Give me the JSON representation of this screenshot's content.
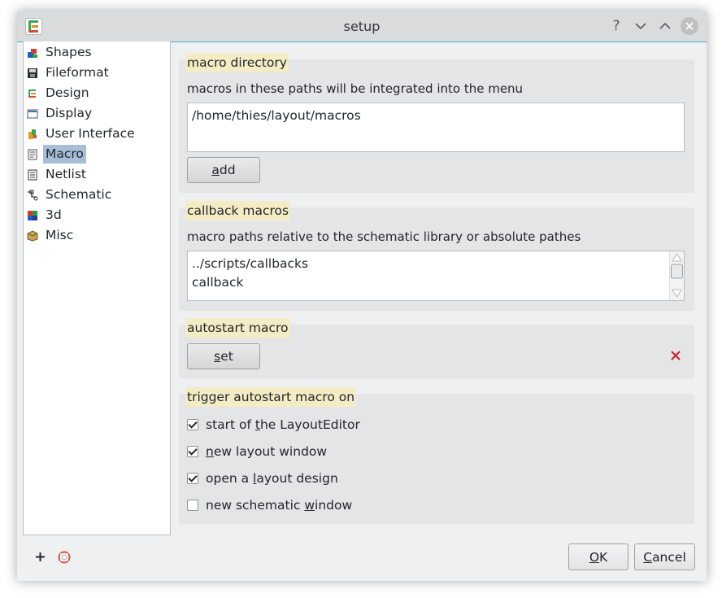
{
  "window": {
    "title": "setup"
  },
  "titlebar": {
    "help": "?",
    "minimize": "⌄",
    "maximize": "⌃",
    "close": "✕"
  },
  "sidebar": {
    "items": [
      {
        "label": "Shapes",
        "icon": "shapes-icon"
      },
      {
        "label": "Fileformat",
        "icon": "floppy-disk-icon"
      },
      {
        "label": "Design",
        "icon": "design-icon"
      },
      {
        "label": "Display",
        "icon": "display-icon"
      },
      {
        "label": "User Interface",
        "icon": "user-interface-icon"
      },
      {
        "label": "Macro",
        "icon": "macro-icon",
        "selected": true
      },
      {
        "label": "Netlist",
        "icon": "netlist-icon"
      },
      {
        "label": "Schematic",
        "icon": "schematic-icon"
      },
      {
        "label": "3d",
        "icon": "3d-icon"
      },
      {
        "label": "Misc",
        "icon": "misc-icon"
      }
    ]
  },
  "macro_directory": {
    "title": "macro directory",
    "description": "macros in these paths will be integrated into the menu",
    "paths": [
      "/home/thies/layout/macros"
    ],
    "add_button": {
      "pre": "",
      "key": "a",
      "post": "dd"
    }
  },
  "callback_macros": {
    "title": "callback macros",
    "description": "macro paths relative to the schematic library or absolute pathes",
    "paths": [
      "../scripts/callbacks",
      "callback"
    ]
  },
  "autostart_macro": {
    "title": "autostart macro",
    "set_button": {
      "pre": "",
      "key": "s",
      "post": "et"
    }
  },
  "trigger": {
    "title": "trigger autostart macro on",
    "options": [
      {
        "pre": "start of ",
        "key": "t",
        "post": "he LayoutEditor",
        "checked": true
      },
      {
        "pre": "",
        "key": "n",
        "post": "ew layout window",
        "checked": true
      },
      {
        "pre": "open a ",
        "key": "l",
        "post": "ayout design",
        "checked": true
      },
      {
        "pre": "new schematic ",
        "key": "w",
        "post": "indow",
        "checked": false
      }
    ]
  },
  "footer": {
    "ok": {
      "pre": "",
      "key": "O",
      "post": "K"
    },
    "cancel": {
      "pre": "",
      "key": "C",
      "post": "ancel"
    }
  },
  "colors": {
    "accent": "#3daee9",
    "selection": "#a7bed9",
    "group_title_bg": "#f4ecc4",
    "remove_icon": "#cc2222"
  }
}
